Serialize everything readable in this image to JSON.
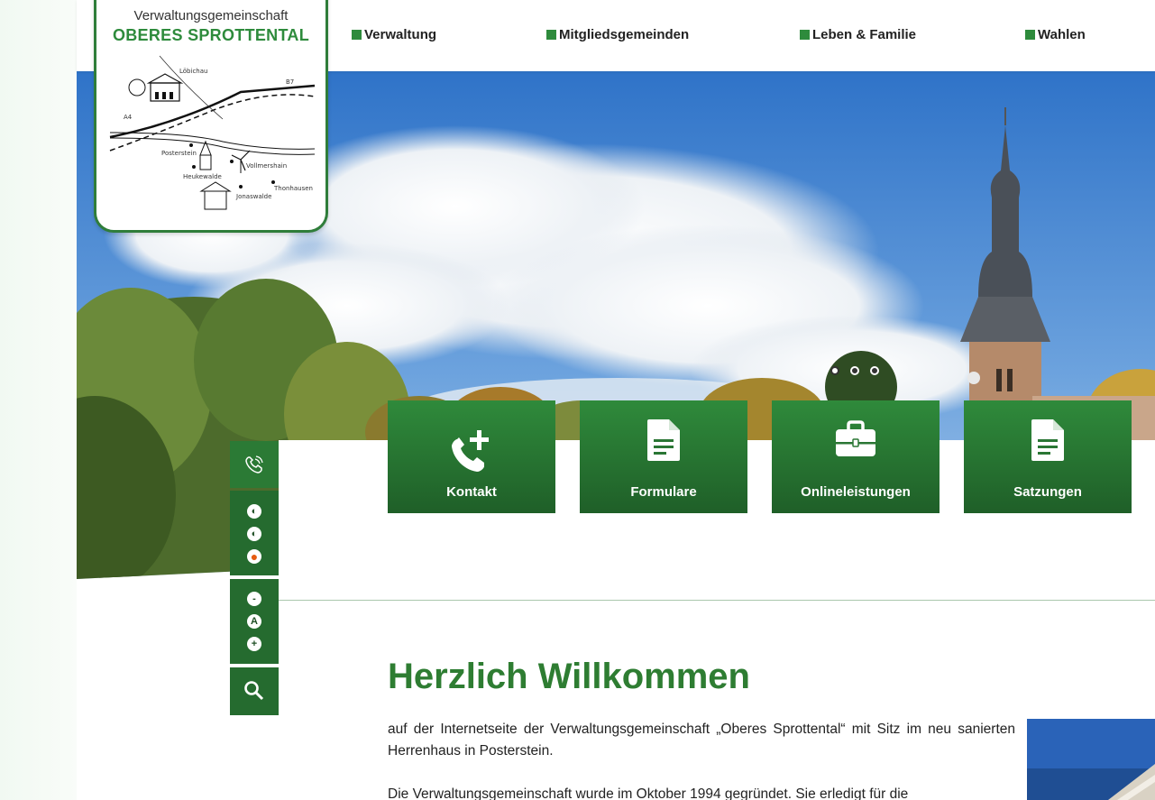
{
  "logo": {
    "line1": "Verwaltungsgemeinschaft",
    "line2": "OBERES SPROTTENTAL",
    "map_labels": [
      "Löbichau",
      "B7",
      "A4",
      "Posterstein",
      "Vollmershain",
      "Heukewalde",
      "Thonhausen",
      "Jonaswalde"
    ]
  },
  "nav": {
    "items": [
      {
        "label": "Verwaltung"
      },
      {
        "label": "Mitgliedsgemeinden"
      },
      {
        "label": "Leben & Familie"
      },
      {
        "label": "Wahlen"
      }
    ]
  },
  "slider": {
    "slide_count": 3,
    "active_index": 0
  },
  "tiles": [
    {
      "label": "Kontakt",
      "icon": "phone-plus-icon"
    },
    {
      "label": "Formulare",
      "icon": "document-icon"
    },
    {
      "label": "Onlineleistungen",
      "icon": "briefcase-icon"
    },
    {
      "label": "Satzungen",
      "icon": "document-icon"
    }
  ],
  "sidebar": {
    "contrast_labels": [
      "◐",
      "◐",
      "●"
    ],
    "font_labels": [
      "-",
      "A",
      "+"
    ]
  },
  "content": {
    "title": "Herzlich Willkommen",
    "para1": "auf der Internetseite der Verwaltungsgemeinschaft „Oberes Sprottental“ mit Sitz im neu sanierten Herrenhaus in Posterstein.",
    "para2": "Die Verwaltungsgemeinschaft wurde im Oktober 1994 gegründet. Sie erledigt für die"
  },
  "colors": {
    "brand_green": "#2e8b3c",
    "tile_dark_green": "#1f5f28",
    "sidebar_green": "#256b2f",
    "accent_orange": "#e65c12"
  }
}
